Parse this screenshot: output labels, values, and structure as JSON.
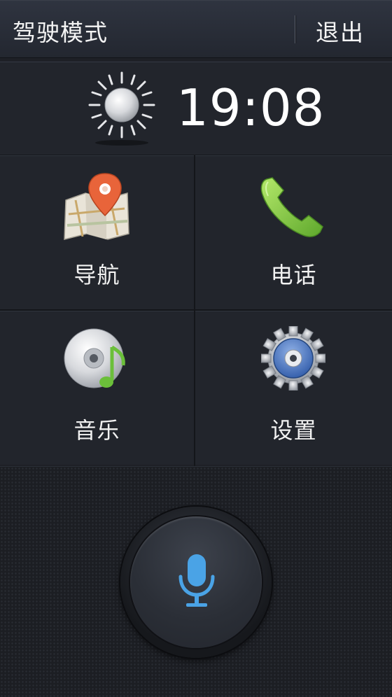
{
  "header": {
    "title": "驾驶模式",
    "exit_label": "退出"
  },
  "clock": {
    "time": "19:08",
    "weather_icon": "sun-icon"
  },
  "tiles": [
    {
      "label": "导航",
      "icon": "map-pin-icon"
    },
    {
      "label": "电话",
      "icon": "phone-icon"
    },
    {
      "label": "音乐",
      "icon": "music-disc-icon"
    },
    {
      "label": "设置",
      "icon": "gear-icon"
    }
  ],
  "voice": {
    "icon": "microphone-icon"
  },
  "colors": {
    "accent": "#4aa3e6",
    "pin": "#e8643a",
    "phone": "#7cc84a",
    "background": "#1e2026"
  }
}
